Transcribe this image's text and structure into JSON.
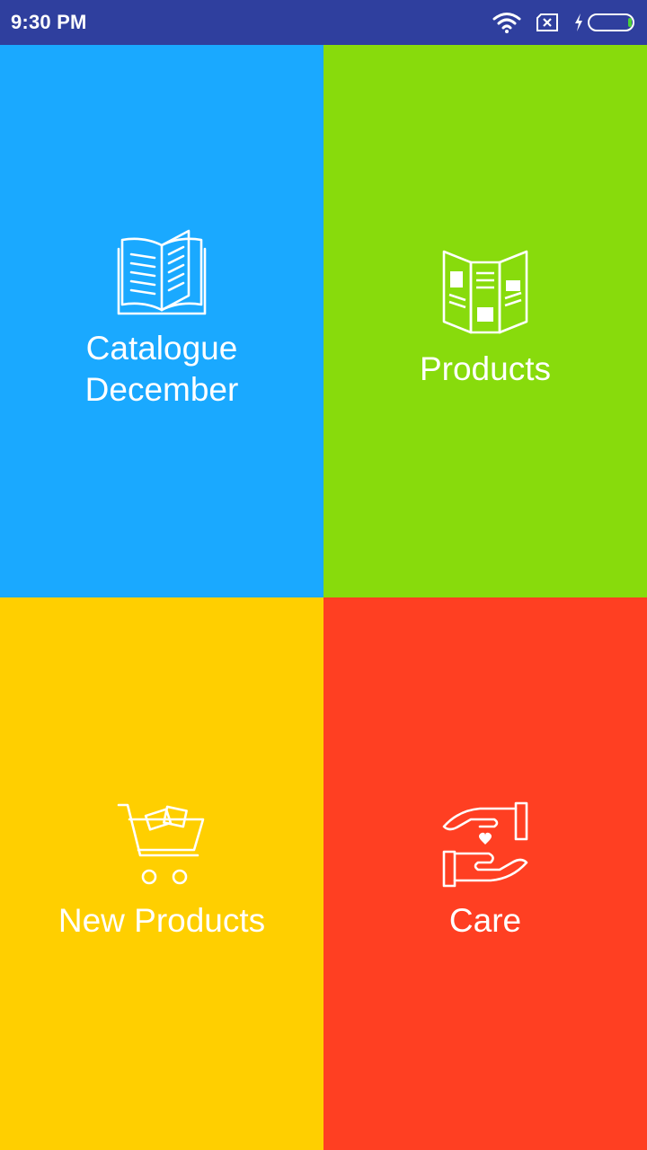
{
  "status_bar": {
    "time": "9:30 PM",
    "background": "#2f3f9e",
    "icons": [
      "wifi-icon",
      "sim-x-icon",
      "charging-icon",
      "battery-icon"
    ]
  },
  "tiles": [
    {
      "label_line1": "Catalogue",
      "label_line2": "December",
      "icon": "open-book-icon",
      "color": "#1aa9ff"
    },
    {
      "label": "Products",
      "icon": "brochure-icon",
      "color": "#88db0c"
    },
    {
      "label": "New Products",
      "icon": "shopping-cart-icon",
      "color": "#ffcf00"
    },
    {
      "label": "Care",
      "icon": "caring-hands-icon",
      "color": "#ff3f22"
    }
  ]
}
